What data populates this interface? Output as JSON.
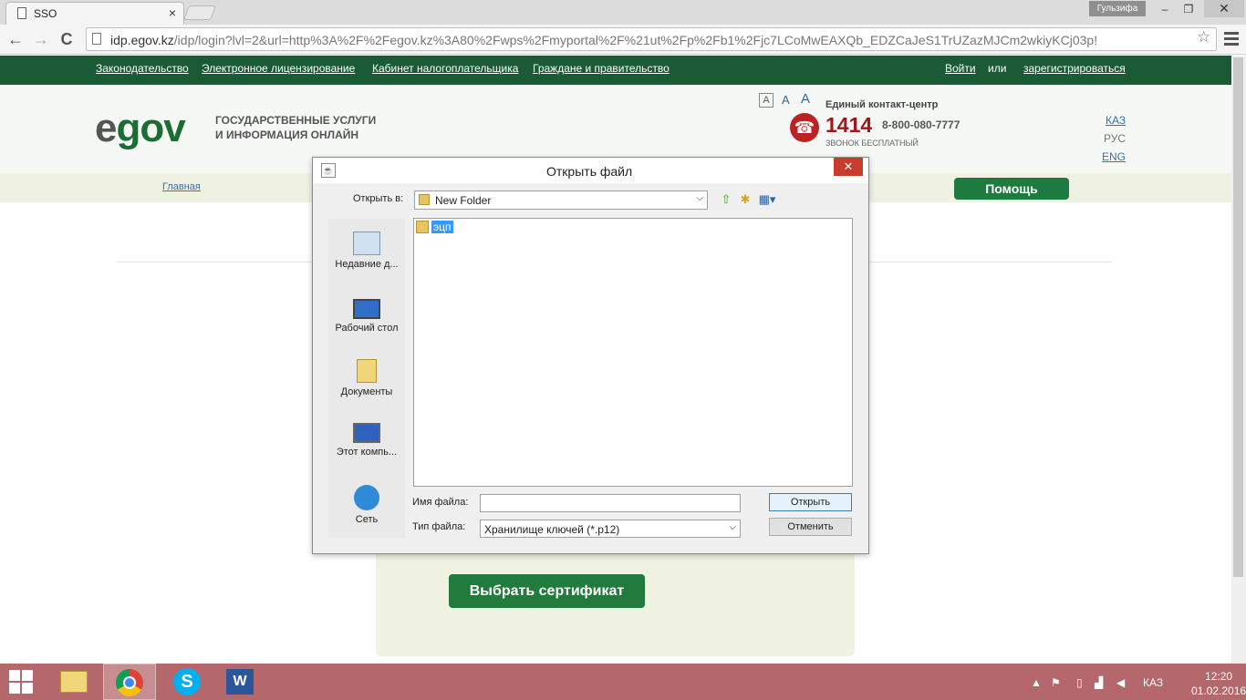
{
  "browser": {
    "tab_title": "SSO",
    "tab_close": "×",
    "user": "Гульзифа",
    "url_host": "idp.egov.kz",
    "url_rest": "/idp/login?lvl=2&url=http%3A%2F%2Fegov.kz%3A80%2Fwps%2Fmyportal%2F%21ut%2Fp%2Fb1%2Fjc7LCoMwEAXQb_EDZCaJeS1TrUZazMJCm2wkiyKCj03p!",
    "back": "←",
    "forward": "→",
    "reload": "C",
    "star": "☆",
    "minimize": "‒",
    "maximize": "❐",
    "close": "✕"
  },
  "topnav": {
    "links": [
      "Законодательство",
      "Электронное лицензирование",
      "Кабинет налогоплательщика",
      "Граждане и правительство"
    ],
    "login": "Войти",
    "or": "или",
    "register": "зарегистрироваться"
  },
  "header": {
    "logo_e": "e",
    "logo_rest": "gov",
    "tagline_1": "ГОСУДАРСТВЕННЫЕ УСЛУГИ",
    "tagline_2": "И ИНФОРМАЦИЯ ОНЛАЙН",
    "font_small": "A",
    "font_mid": "A",
    "font_large": "A",
    "contact_label": "Единый контакт-центр",
    "contact_short": "1414",
    "contact_long": "8-800-080-7777",
    "contact_free": "ЗВОНОК БЕСПЛАТНЫЙ",
    "langs": [
      "КАЗ",
      "РУС",
      "ENG"
    ]
  },
  "subnav": {
    "home": "Главная",
    "help": "Помощь"
  },
  "main": {
    "choose_cert": "Выбрать сертификат"
  },
  "dialog": {
    "title": "Открыть файл",
    "close": "✕",
    "java_icon": "☕",
    "look_in_label": "Открыть в:",
    "look_in_value": "New Folder",
    "places": [
      "Недавние д...",
      "Рабочий стол",
      "Документы",
      "Этот компь...",
      "Сеть"
    ],
    "files": [
      "эцп"
    ],
    "file_name_label": "Имя файла:",
    "file_name_value": "",
    "file_type_label": "Тип файла:",
    "file_type_value": "Хранилище ключей (*.p12)",
    "open_button": "Открыть",
    "cancel_button": "Отменить"
  },
  "taskbar": {
    "lang": "КАЗ",
    "time": "12:20",
    "date": "01.02.2016"
  },
  "colors": {
    "brand_green": "#1a5b36",
    "button_green": "#227a3d",
    "taskbar": "#b4686c",
    "phone_red": "#a3151b"
  }
}
